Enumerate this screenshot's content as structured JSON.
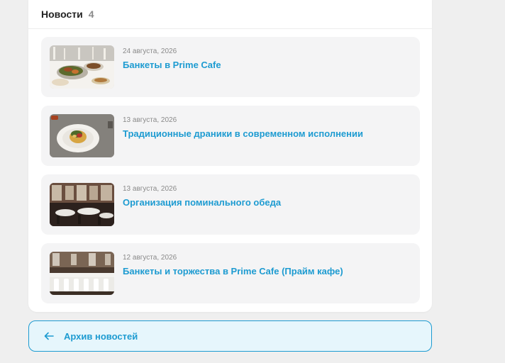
{
  "news": {
    "title": "Новости",
    "count": "4",
    "items": [
      {
        "date": "24 августа, 2026",
        "title": "Банкеты в Prime Cafe",
        "image": "banquet-table-food-thumbnail"
      },
      {
        "date": "13 августа, 2026",
        "title": "Традиционные драники в современном исполнении",
        "image": "draniki-plate-thumbnail"
      },
      {
        "date": "13 августа, 2026",
        "title": "Организация поминального обеда",
        "image": "restaurant-hall-thumbnail"
      },
      {
        "date": "12 августа, 2026",
        "title": "Банкеты и торжества в Prime Cafe (Прайм кафе)",
        "image": "banquet-hall-white-chairs-thumbnail"
      }
    ]
  },
  "archive": {
    "label": "Архив новостей",
    "icon": "arrow-left-icon"
  },
  "colors": {
    "accent": "#1d9bd1",
    "archive_bg": "#e6f6fc",
    "item_bg": "#f4f4f5",
    "page_bg": "#efefef"
  }
}
